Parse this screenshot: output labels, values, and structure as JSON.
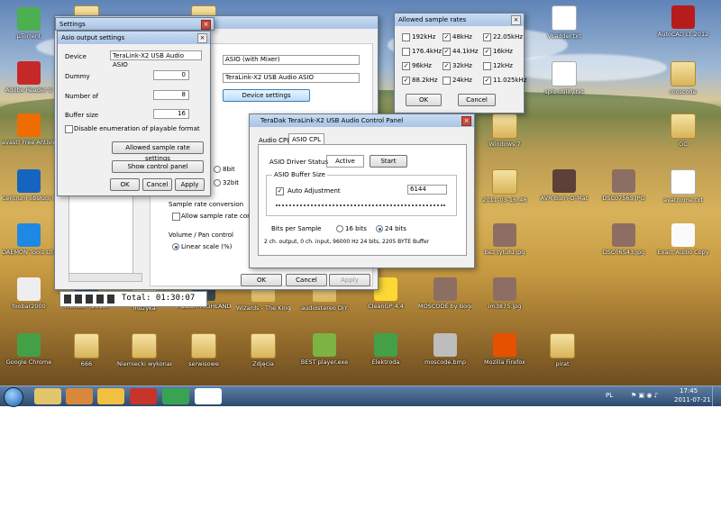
{
  "desktop": {
    "icons": [
      {
        "label": "µTorrent",
        "icon": "utorrent-icon"
      },
      {
        "label": "Adobe Reader 9",
        "icon": "adobe-reader-icon"
      },
      {
        "label": "avast! Free Antivirus",
        "icon": "avast-icon"
      },
      {
        "label": "Centrum obsługi HP",
        "icon": "hp-icon"
      },
      {
        "label": "DAEMON Tools Lite",
        "icon": "daemon-tools-icon"
      },
      {
        "label": "foobar2000",
        "icon": "foobar-icon"
      },
      {
        "label": "Google Chrome",
        "icon": "chrome-icon"
      },
      {
        "label": "666",
        "icon": "folder-icon"
      },
      {
        "label": "Niemiecki wykonanie",
        "icon": "folder-icon"
      },
      {
        "label": "serwisowe",
        "icon": "folder-icon"
      },
      {
        "label": "Zdjęcia",
        "icon": "folder-icon"
      },
      {
        "label": "BEST player.exe",
        "icon": "exe-icon"
      },
      {
        "label": "Elektroda",
        "icon": "chrome-icon"
      },
      {
        "label": "moscode.bmp",
        "icon": "bmp-icon"
      },
      {
        "label": "Mozilla Firefox",
        "icon": "firefox-icon"
      },
      {
        "label": "pirat",
        "icon": "folder-icon"
      },
      {
        "label": "mp3",
        "icon": "folder-icon"
      },
      {
        "label": "mp3",
        "icon": "folder-icon"
      },
      {
        "label": "Frontier (2010)",
        "icon": "video-icon"
      },
      {
        "label": "muzyka",
        "icon": "folder-icon"
      },
      {
        "label": "POLISH HIGHLANDERS",
        "icon": "video-icon"
      },
      {
        "label": "Wizards - The Kingdom (2002)",
        "icon": "folder-icon"
      },
      {
        "label": "audiostereo DIY",
        "icon": "folder-icon"
      },
      {
        "label": "CleanGP 4.4",
        "icon": "cleangp-icon"
      },
      {
        "label": "MOSCODE by Bogdan.jpg",
        "icon": "image-icon"
      },
      {
        "label": "im3875.jpg",
        "icon": "image-icon"
      },
      {
        "label": "VLadder.txt",
        "icon": "text-file-icon"
      },
      {
        "label": "AutoCAD LT 2012",
        "icon": "autocad-icon"
      },
      {
        "label": "spis utility.txt",
        "icon": "text-file-icon"
      },
      {
        "label": "moscode",
        "icon": "folder-icon"
      },
      {
        "label": "Windows 7",
        "icon": "folder-icon"
      },
      {
        "label": "GC",
        "icon": "folder-icon"
      },
      {
        "label": "2011-03-16_46",
        "icon": "folder-icon"
      },
      {
        "label": "AVR Burn-O-Mat",
        "icon": "avr-icon"
      },
      {
        "label": "DSC07565.JPG",
        "icon": "image-icon"
      },
      {
        "label": "avatnome.txt",
        "icon": "text-file-icon"
      },
      {
        "label": "bez tytułu.jpg",
        "icon": "image-icon"
      },
      {
        "label": "DSC06543.jpg",
        "icon": "image-icon"
      },
      {
        "label": "Exact Audio Copy",
        "icon": "eac-icon"
      }
    ]
  },
  "bg_window": {
    "mode_select": "ASIO (with Mixer)",
    "device_select": "TeraLink-X2 USB Audio ASIO",
    "device_settings_button": "Device settings",
    "bit_options": [
      "8bit",
      "32bit"
    ],
    "rate_conversion_label": "Sample rate conversion",
    "allow_rate_conversion": "Allow sample rate conversion",
    "volume_label": "Volume / Pan control",
    "linear_scale": "Linear scale (%)",
    "ok": "OK",
    "cancel": "Cancel",
    "apply": "Apply",
    "total_label": "Total: 01:30:07"
  },
  "settings_window": {
    "title": "Settings"
  },
  "asio_output": {
    "title": "Asio output settings",
    "device_label": "Device",
    "device_value": "TeraLink-X2 USB Audio ASIO",
    "dummy_label": "Dummy",
    "dummy_value": "0",
    "number_label": "Number of",
    "number_value": "8",
    "buffer_label": "Buffer size",
    "buffer_value": "16",
    "disable_enum": "Disable enumeration of playable format",
    "allowed_rates_button": "Allowed sample rate settings",
    "show_cp_button": "Show control panel",
    "ok": "OK",
    "cancel": "Cancel",
    "apply": "Apply"
  },
  "allowed_rates": {
    "title": "Allowed sample rates",
    "rates": [
      {
        "label": "192kHz",
        "checked": false
      },
      {
        "label": "48kHz",
        "checked": true
      },
      {
        "label": "22.05kHz",
        "checked": true
      },
      {
        "label": "176.4kHz",
        "checked": false
      },
      {
        "label": "44.1kHz",
        "checked": true
      },
      {
        "label": "16kHz",
        "checked": true
      },
      {
        "label": "96kHz",
        "checked": true
      },
      {
        "label": "32kHz",
        "checked": true
      },
      {
        "label": "12kHz",
        "checked": false
      },
      {
        "label": "88.2kHz",
        "checked": true
      },
      {
        "label": "24kHz",
        "checked": false
      },
      {
        "label": "11.025kHz",
        "checked": true
      }
    ],
    "ok": "OK",
    "cancel": "Cancel"
  },
  "control_panel": {
    "title": "TeraDak TeraLink-X2 USB Audio Control Panel",
    "tab_audio": "Audio CPL",
    "tab_asio": "ASIO CPL",
    "driver_status_label": "ASIO Driver Status",
    "status_value": "Active",
    "start_button": "Start",
    "buffer_size_label": "ASIO Buffer Size",
    "auto_adjust": "Auto Adjustment",
    "buffer_value": "6144",
    "bits_label": "Bits per Sample",
    "bits_16": "16 bits",
    "bits_24": "24 bits",
    "status_line": "2 ch. output, 0 ch. input, 96000 Hz  24 bits,  2205 BYTE Buffer"
  },
  "taskbar": {
    "lang": "PL",
    "time": "17:45",
    "date": "2011-07-21"
  }
}
